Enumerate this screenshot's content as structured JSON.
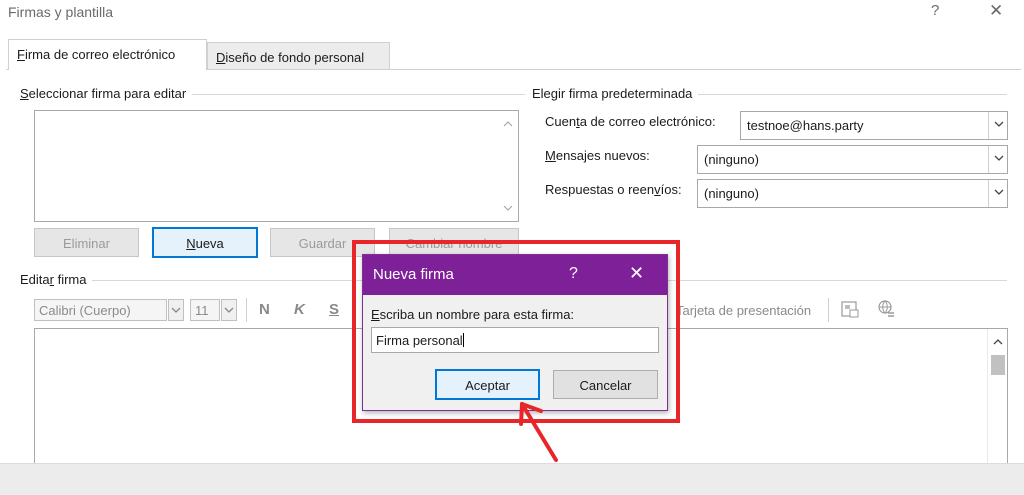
{
  "window": {
    "title": "Firmas y plantilla",
    "help": "?",
    "close": "✕"
  },
  "tabs": [
    {
      "label_pre": "",
      "label_u": "F",
      "label_post": "irma de correo electrónico"
    },
    {
      "label_pre": "",
      "label_u": "D",
      "label_post": "iseño de fondo personal"
    }
  ],
  "select_section": {
    "label_pre": "",
    "label_u": "S",
    "label_post": "eleccionar firma para editar"
  },
  "buttons": {
    "delete": "Eliminar",
    "new_u": "N",
    "new_post": "ueva",
    "save": "Guardar",
    "rename": "Cambiar nombre"
  },
  "default_section": {
    "title": "Elegir firma predeterminada",
    "account_label_pre": "Cuen",
    "account_label_u": "t",
    "account_label_post": "a de correo electrónico:",
    "account_value": "testnoe@hans.party",
    "new_messages_label_pre": "",
    "new_messages_label_u": "M",
    "new_messages_label_post": "ensajes nuevos:",
    "new_messages_value": "(ninguno)",
    "replies_label_pre": "Respuestas o reen",
    "replies_label_u": "v",
    "replies_label_post": "íos:",
    "replies_value": "(ninguno)"
  },
  "edit_section": {
    "label_pre": "Edita",
    "label_u": "r",
    "label_post": " firma"
  },
  "toolbar": {
    "font": "Calibri (Cuerpo)",
    "size": "11",
    "bold": "N",
    "italic": "K",
    "underline": "S",
    "business_card": "Tarjeta de presentación"
  },
  "dialog": {
    "title": "Nueva firma",
    "help": "?",
    "close": "✕",
    "prompt_u": "E",
    "prompt_post": "scriba un nombre para esta firma:",
    "input_value": "Firma personal",
    "ok": "Aceptar",
    "cancel": "Cancelar"
  },
  "colors": {
    "dialog_title": "#7e2198",
    "highlight": "#e8262a",
    "focus": "#0078d7"
  }
}
